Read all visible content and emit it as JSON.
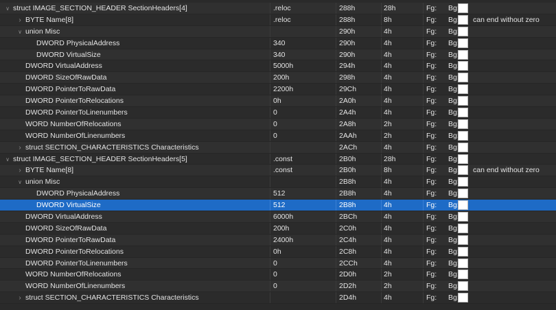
{
  "rows": [
    {
      "indent": 0,
      "arrow": "open",
      "name": "struct IMAGE_SECTION_HEADER SectionHeaders[4]",
      "value": ".reloc",
      "start": "288h",
      "size": "28h",
      "fg": "Fg:",
      "bg": "Bg:",
      "comment": ""
    },
    {
      "indent": 1,
      "arrow": "closed",
      "name": "BYTE Name[8]",
      "value": ".reloc",
      "start": "288h",
      "size": "8h",
      "fg": "Fg:",
      "bg": "Bg:",
      "comment": "can end without zero"
    },
    {
      "indent": 1,
      "arrow": "open",
      "name": "union Misc",
      "value": "",
      "start": "290h",
      "size": "4h",
      "fg": "Fg:",
      "bg": "Bg:",
      "comment": ""
    },
    {
      "indent": 2,
      "arrow": "none",
      "name": "DWORD PhysicalAddress",
      "value": "340",
      "start": "290h",
      "size": "4h",
      "fg": "Fg:",
      "bg": "Bg:",
      "comment": ""
    },
    {
      "indent": 2,
      "arrow": "none",
      "name": "DWORD VirtualSize",
      "value": "340",
      "start": "290h",
      "size": "4h",
      "fg": "Fg:",
      "bg": "Bg:",
      "comment": ""
    },
    {
      "indent": 1,
      "arrow": "none",
      "name": "DWORD VirtualAddress",
      "value": "5000h",
      "start": "294h",
      "size": "4h",
      "fg": "Fg:",
      "bg": "Bg:",
      "comment": ""
    },
    {
      "indent": 1,
      "arrow": "none",
      "name": "DWORD SizeOfRawData",
      "value": "200h",
      "start": "298h",
      "size": "4h",
      "fg": "Fg:",
      "bg": "Bg:",
      "comment": ""
    },
    {
      "indent": 1,
      "arrow": "none",
      "name": "DWORD PointerToRawData",
      "value": "2200h",
      "start": "29Ch",
      "size": "4h",
      "fg": "Fg:",
      "bg": "Bg:",
      "comment": ""
    },
    {
      "indent": 1,
      "arrow": "none",
      "name": "DWORD PointerToRelocations",
      "value": "0h",
      "start": "2A0h",
      "size": "4h",
      "fg": "Fg:",
      "bg": "Bg:",
      "comment": ""
    },
    {
      "indent": 1,
      "arrow": "none",
      "name": "DWORD PointerToLinenumbers",
      "value": "0",
      "start": "2A4h",
      "size": "4h",
      "fg": "Fg:",
      "bg": "Bg:",
      "comment": ""
    },
    {
      "indent": 1,
      "arrow": "none",
      "name": "WORD NumberOfRelocations",
      "value": "0",
      "start": "2A8h",
      "size": "2h",
      "fg": "Fg:",
      "bg": "Bg:",
      "comment": ""
    },
    {
      "indent": 1,
      "arrow": "none",
      "name": "WORD NumberOfLinenumbers",
      "value": "0",
      "start": "2AAh",
      "size": "2h",
      "fg": "Fg:",
      "bg": "Bg:",
      "comment": ""
    },
    {
      "indent": 1,
      "arrow": "closed",
      "name": "struct SECTION_CHARACTERISTICS Characteristics",
      "value": "",
      "start": "2ACh",
      "size": "4h",
      "fg": "Fg:",
      "bg": "Bg:",
      "comment": ""
    },
    {
      "indent": 0,
      "arrow": "open",
      "name": "struct IMAGE_SECTION_HEADER SectionHeaders[5]",
      "value": ".const",
      "start": "2B0h",
      "size": "28h",
      "fg": "Fg:",
      "bg": "Bg:",
      "comment": ""
    },
    {
      "indent": 1,
      "arrow": "closed",
      "name": "BYTE Name[8]",
      "value": ".const",
      "start": "2B0h",
      "size": "8h",
      "fg": "Fg:",
      "bg": "Bg:",
      "comment": "can end without zero"
    },
    {
      "indent": 1,
      "arrow": "open",
      "name": "union Misc",
      "value": "",
      "start": "2B8h",
      "size": "4h",
      "fg": "Fg:",
      "bg": "Bg:",
      "comment": ""
    },
    {
      "indent": 2,
      "arrow": "none",
      "name": "DWORD PhysicalAddress",
      "value": "512",
      "start": "2B8h",
      "size": "4h",
      "fg": "Fg:",
      "bg": "Bg:",
      "comment": ""
    },
    {
      "indent": 2,
      "arrow": "none",
      "name": "DWORD VirtualSize",
      "value": "512",
      "start": "2B8h",
      "size": "4h",
      "fg": "Fg:",
      "bg": "Bg:",
      "comment": "",
      "selected": true
    },
    {
      "indent": 1,
      "arrow": "none",
      "name": "DWORD VirtualAddress",
      "value": "6000h",
      "start": "2BCh",
      "size": "4h",
      "fg": "Fg:",
      "bg": "Bg:",
      "comment": ""
    },
    {
      "indent": 1,
      "arrow": "none",
      "name": "DWORD SizeOfRawData",
      "value": "200h",
      "start": "2C0h",
      "size": "4h",
      "fg": "Fg:",
      "bg": "Bg:",
      "comment": ""
    },
    {
      "indent": 1,
      "arrow": "none",
      "name": "DWORD PointerToRawData",
      "value": "2400h",
      "start": "2C4h",
      "size": "4h",
      "fg": "Fg:",
      "bg": "Bg:",
      "comment": ""
    },
    {
      "indent": 1,
      "arrow": "none",
      "name": "DWORD PointerToRelocations",
      "value": "0h",
      "start": "2C8h",
      "size": "4h",
      "fg": "Fg:",
      "bg": "Bg:",
      "comment": ""
    },
    {
      "indent": 1,
      "arrow": "none",
      "name": "DWORD PointerToLinenumbers",
      "value": "0",
      "start": "2CCh",
      "size": "4h",
      "fg": "Fg:",
      "bg": "Bg:",
      "comment": ""
    },
    {
      "indent": 1,
      "arrow": "none",
      "name": "WORD NumberOfRelocations",
      "value": "0",
      "start": "2D0h",
      "size": "2h",
      "fg": "Fg:",
      "bg": "Bg:",
      "comment": ""
    },
    {
      "indent": 1,
      "arrow": "none",
      "name": "WORD NumberOfLinenumbers",
      "value": "0",
      "start": "2D2h",
      "size": "2h",
      "fg": "Fg:",
      "bg": "Bg:",
      "comment": ""
    },
    {
      "indent": 1,
      "arrow": "closed",
      "name": "struct SECTION_CHARACTERISTICS Characteristics",
      "value": "",
      "start": "2D4h",
      "size": "4h",
      "fg": "Fg:",
      "bg": "Bg:",
      "comment": ""
    }
  ],
  "icons": {
    "expanded": "chevron-down-icon",
    "collapsed": "chevron-right-icon",
    "bg_swatch": "color-swatch"
  },
  "colors": {
    "background": "#2a2a2a",
    "selection": "#1e6bc6",
    "swatch": "#ffffff"
  }
}
